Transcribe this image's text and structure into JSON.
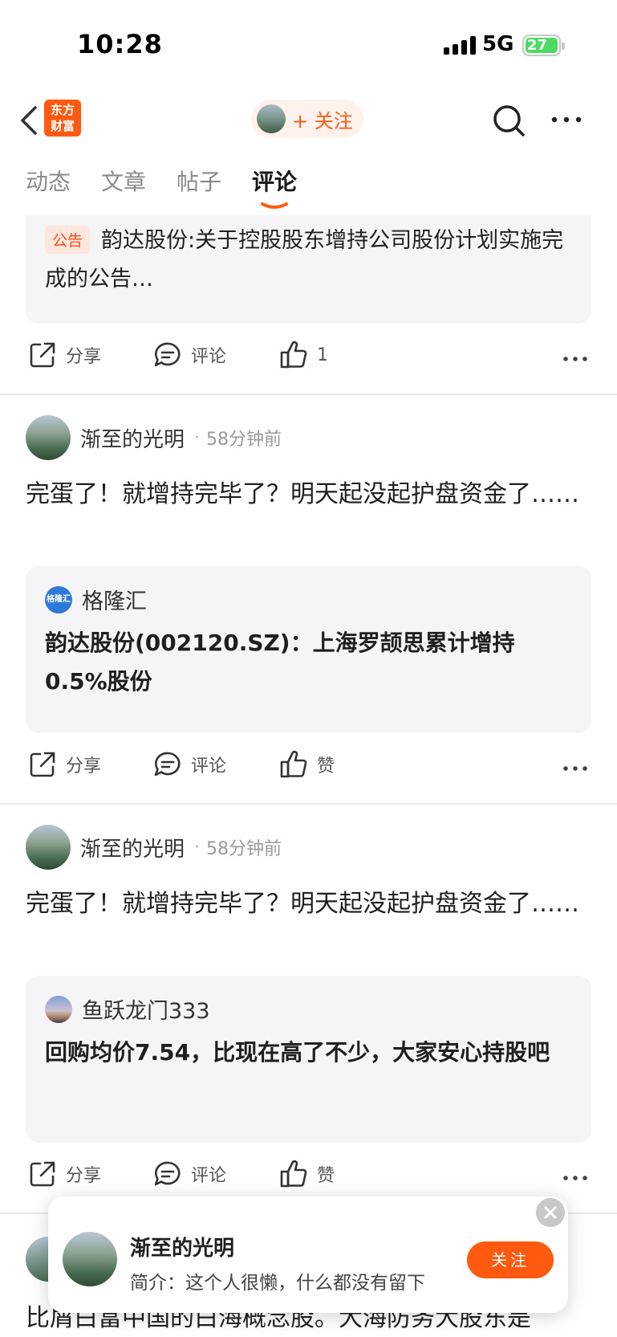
{
  "status_bar": {
    "time": "10:28",
    "network": "5G",
    "battery": "27"
  },
  "nav": {
    "logo_text": "东方财富",
    "follow_label": "+ 关注"
  },
  "tabs": [
    {
      "label": "动态",
      "active": false
    },
    {
      "label": "文章",
      "active": false
    },
    {
      "label": "帖子",
      "active": false
    },
    {
      "label": "评论",
      "active": true
    }
  ],
  "top_card": {
    "badge": "公告",
    "title": "韵达股份:关于控股股东增持公司股份计划实施完成的公告…",
    "actions": {
      "share": "分享",
      "comment": "评论",
      "like": "1"
    }
  },
  "posts": [
    {
      "author": "渐至的光明",
      "time": "58分钟前",
      "text": "完蛋了！就增持完毕了？明天起没起护盘资金了……",
      "quote": {
        "source": "格隆汇",
        "source_icon_text": "格隆汇",
        "text": "韵达股份(002120.SZ)：上海罗颉思累计增持0.5%股份"
      },
      "actions": {
        "share": "分享",
        "comment": "评论",
        "like": "赞"
      }
    },
    {
      "author": "渐至的光明",
      "time": "58分钟前",
      "text": "完蛋了！就增持完毕了？明天起没起护盘资金了……",
      "quote": {
        "source": "鱼跃龙门333",
        "text": "回购均价7.54，比现在高了不少，大家安心持股吧"
      },
      "actions": {
        "share": "分享",
        "comment": "评论",
        "like": "赞"
      }
    }
  ],
  "behind_text": "比屑白富中国的白海概念股。大海防务大股东是",
  "popup": {
    "name": "渐至的光明",
    "bio": "简介：这个人很懒，什么都没有留下",
    "follow": "关注"
  }
}
